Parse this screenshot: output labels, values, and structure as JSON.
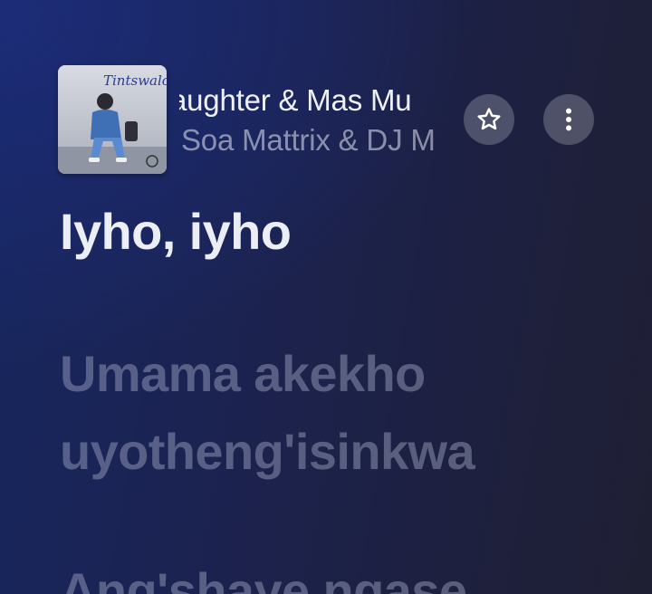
{
  "now_playing": {
    "title": "aughter & Mas Mu",
    "artist": "Soa Mattrix & DJ M",
    "artwork": {
      "script_text": "Tintswalo",
      "icon": "album-artwork"
    },
    "favorite_icon": "star-outline-icon",
    "more_icon": "vertical-ellipsis-icon"
  },
  "lyrics": {
    "lines": [
      "Iyho, iyho",
      "Umama akekho",
      "uyotheng'isinkwa",
      "Ang'shaye ngase"
    ],
    "active_index": 0
  },
  "colors": {
    "background_accent": "#17265f",
    "background_base": "#1f1f33",
    "active_lyric": "#eceef6",
    "inactive_lyric": "#8a90aa"
  }
}
